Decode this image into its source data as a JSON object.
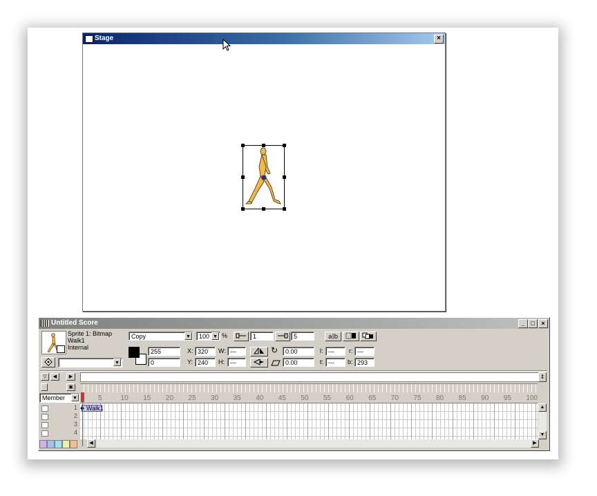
{
  "stage": {
    "title": "Stage",
    "close_label": "×"
  },
  "score": {
    "title": "Untitled Score",
    "win_buttons": [
      "_",
      "□",
      "×"
    ],
    "sprite_info": {
      "line1": "Sprite 1: Bitmap",
      "line2": "Walk1",
      "line3": "Internal"
    },
    "ink": "Copy",
    "blend": "100",
    "blend_unit": "%",
    "start_frame": "1",
    "end_frame": "5",
    "fore_color_value": "255",
    "back_color_value": "0",
    "x_label": "X:",
    "x_value": "320",
    "y_label": "Y:",
    "y_value": "240",
    "w_label": "W:",
    "w_value": "---",
    "h_label": "H:",
    "h_value": "---",
    "rotation_value": "0.00",
    "skew_value": "0.00",
    "l_label": "l:",
    "l_value": "---",
    "r_label": "r:",
    "r_value": "---",
    "t_label": "t:",
    "t_value": "---",
    "b_label": "b:",
    "b_value": "293",
    "channel_dropdown": "Member",
    "frame_ticks": [
      "5",
      "10",
      "15",
      "20",
      "25",
      "30",
      "35",
      "40",
      "45",
      "50",
      "55",
      "60",
      "65",
      "70",
      "75",
      "80",
      "85",
      "90",
      "95",
      "100"
    ],
    "channels": [
      "1",
      "2",
      "3",
      "4"
    ],
    "sprite_span_label": "Walk1",
    "colors": {
      "title_active": "#0a246a",
      "title_inactive": "#808080",
      "playhead": "#cc3344",
      "sprite_span": "#c8c8f0",
      "chrome": "#d4d0c8"
    }
  }
}
